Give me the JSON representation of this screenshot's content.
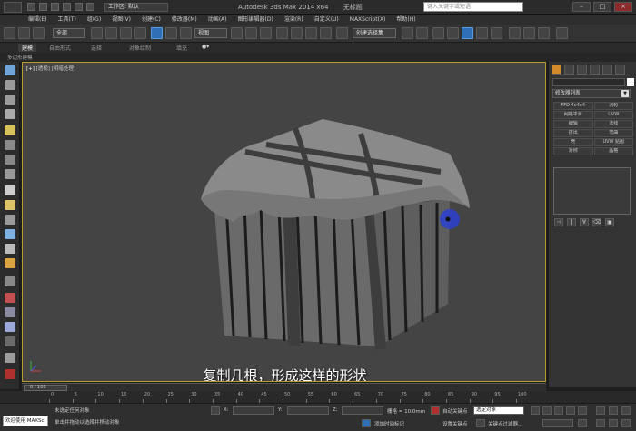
{
  "titlebar": {
    "workspace_label": "工作区: 默认",
    "app_title": "Autodesk 3ds Max 2014 x64",
    "file_title": "无标题",
    "search_placeholder": "键入关键字或短语",
    "window_controls": [
      "–",
      "□",
      "×"
    ]
  },
  "menubar": {
    "items": [
      "编辑(E)",
      "工具(T)",
      "组(G)",
      "视图(V)",
      "创建(C)",
      "修改器(M)",
      "动画(A)",
      "图形编辑器(D)",
      "渲染(R)",
      "自定义(U)",
      "MAXScript(X)",
      "帮助(H)"
    ]
  },
  "toolbar": {
    "selection_filter": "全部",
    "view_dropdown": "视图",
    "named_selection": "创建选择集"
  },
  "ribbon": {
    "tabs": [
      "建模",
      "自由形式",
      "选择",
      "对象绘制",
      "填充"
    ],
    "sub_label": "多边形建模"
  },
  "viewport": {
    "label_plus": "[+]",
    "label_view": "[透视]",
    "label_shading": "[明暗处理]",
    "caption": "复制几根，形成这样的形状"
  },
  "command_panel": {
    "modifier_list": "修改器列表",
    "modifier_buttons": [
      "FFD 4x4x4",
      "涡轮",
      "网格平滑",
      "UVW",
      "编辑",
      "法线",
      "挤出",
      "弯曲",
      "壳",
      "UVW 贴图",
      "对称",
      "晶格"
    ],
    "icon_buttons": [
      "⊣",
      "‖",
      "∀",
      "⌫",
      "▣"
    ]
  },
  "timeline": {
    "frame_counter": "0 / 100",
    "ticks": [
      "0",
      "5",
      "10",
      "15",
      "20",
      "25",
      "30",
      "35",
      "40",
      "45",
      "50",
      "55",
      "60",
      "65",
      "70",
      "75",
      "80",
      "85",
      "90",
      "95",
      "100"
    ]
  },
  "statusbar": {
    "maxscript_label": "欢迎使用 MAXSc",
    "status_line1": "未选定任何对象",
    "status_line2": "单击并拖动以选择并移动对象",
    "x_label": "X:",
    "y_label": "Y:",
    "z_label": "Z:",
    "grid_label": "栅格 = 10.0mm",
    "add_time_tag": "添加时间标记",
    "auto_key": "自动关键点",
    "selected_dropdown": "选定对象",
    "set_key": "设置关键点",
    "key_filters": "关键点过滤器..."
  },
  "colors": {
    "viewport_bg": "#444444",
    "viewport_border": "#b89a30",
    "accent_blue": "#2f6fb5",
    "active_tab": "#d38a2a"
  }
}
